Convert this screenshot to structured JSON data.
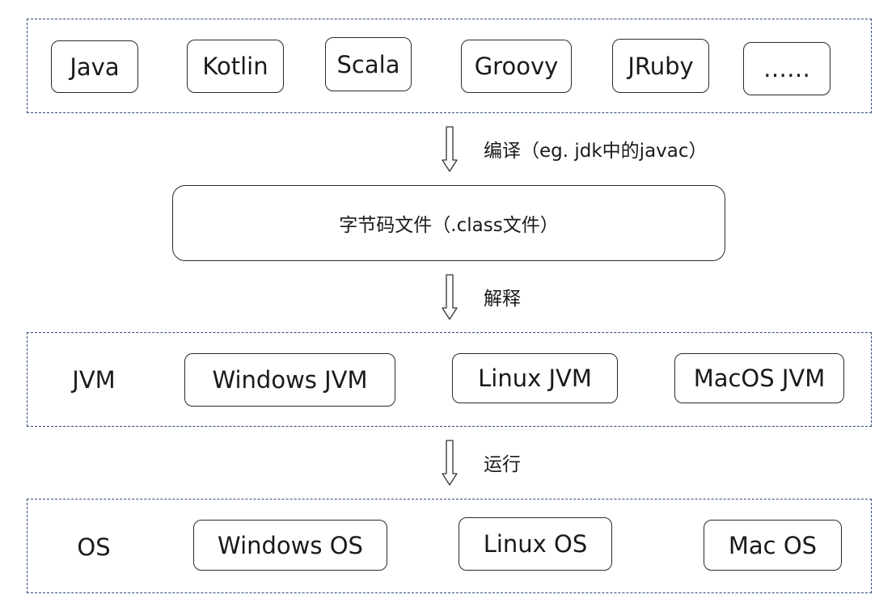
{
  "languages": [
    "Java",
    "Kotlin",
    "Scala",
    "Groovy",
    "JRuby",
    "……"
  ],
  "compile": {
    "label": "编译（eg. jdk中的javac）"
  },
  "bytecode": {
    "label": "字节码文件（.class文件）"
  },
  "interpret": {
    "label": "解释"
  },
  "jvm": {
    "title": "JVM",
    "items": [
      "Windows JVM",
      "Linux JVM",
      "MacOS JVM"
    ]
  },
  "run": {
    "label": "运行"
  },
  "os": {
    "title": "OS",
    "items": [
      "Windows OS",
      "Linux OS",
      "Mac OS"
    ]
  }
}
